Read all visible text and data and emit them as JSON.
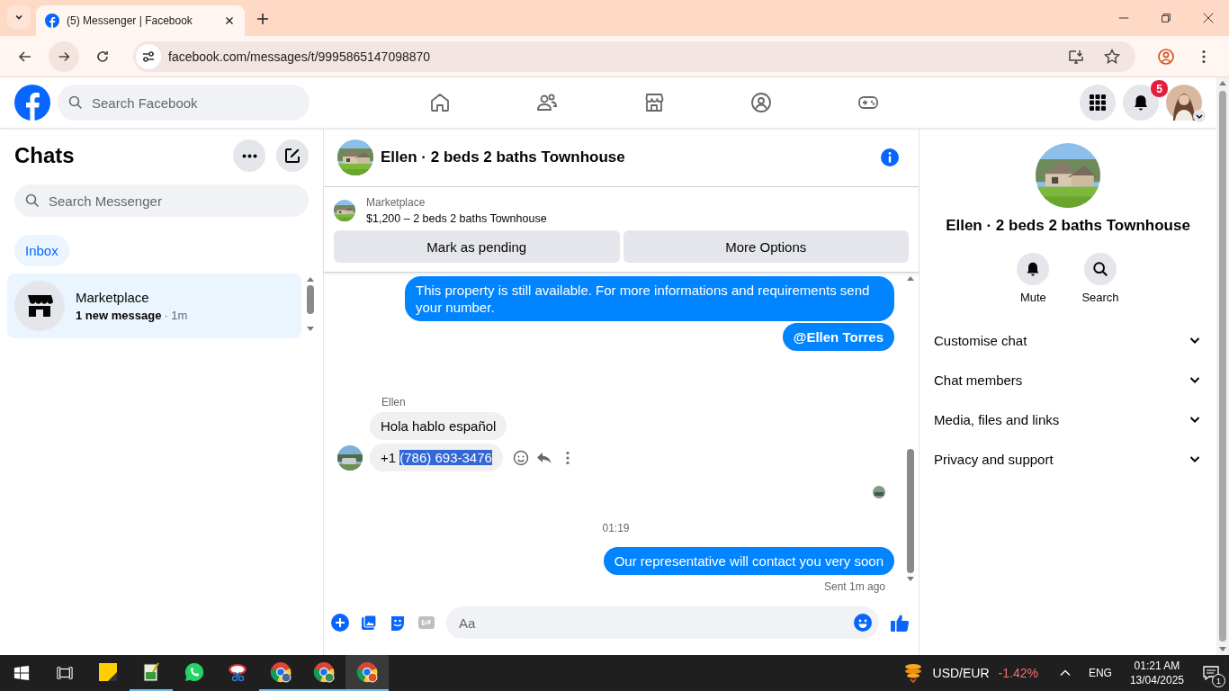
{
  "browser": {
    "tab_title": "(5) Messenger | Facebook",
    "url": "facebook.com/messages/t/9995865147098870"
  },
  "facebook": {
    "search_placeholder": "Search Facebook",
    "notification_count": "5"
  },
  "chats": {
    "title": "Chats",
    "search_placeholder": "Search Messenger",
    "filters": [
      {
        "label": "Inbox",
        "selected": true
      }
    ],
    "conversations": [
      {
        "name": "Marketplace",
        "preview": "1 new message",
        "time": "· 1m",
        "unread": true,
        "selected": true
      }
    ]
  },
  "conversation": {
    "title": "Ellen · 2 beds 2 baths Townhouse",
    "listing": {
      "source": "Marketplace",
      "summary": "$1,200 – 2 beds 2 baths Townhouse"
    },
    "actions": [
      "Mark as pending",
      "More Options"
    ],
    "messages": [
      {
        "kind": "outgoing",
        "text": "This property is still available. For more informations and requirements send your number.",
        "mention": false
      },
      {
        "kind": "outgoing",
        "text": "@Ellen Torres",
        "mention": true
      },
      {
        "kind": "sender",
        "text": "Ellen"
      },
      {
        "kind": "incoming",
        "text": "Hola hablo español",
        "show_avatar": false,
        "hovered": false
      },
      {
        "kind": "incoming",
        "text": "+1 ",
        "highlighted": "(786) 693-3476",
        "show_avatar": true,
        "hovered": true
      },
      {
        "kind": "seen"
      },
      {
        "kind": "time",
        "text": "01:19"
      },
      {
        "kind": "outgoing",
        "text": "Our representative will contact you very soon",
        "mention": false
      },
      {
        "kind": "status",
        "text": "Sent 1m ago"
      }
    ],
    "composer_placeholder": "Aa"
  },
  "details": {
    "name": "Ellen · 2 beds 2 baths Townhouse",
    "actions": [
      "Mute",
      "Search"
    ],
    "sections": [
      {
        "label": "Customise chat",
        "expanded": false
      },
      {
        "label": "Chat members",
        "expanded": false
      },
      {
        "label": "Media, files and links",
        "expanded": false
      },
      {
        "label": "Privacy and support",
        "expanded": false
      }
    ]
  },
  "taskbar": {
    "apps": [
      {
        "running": false,
        "selected": false
      },
      {
        "running": true,
        "selected": false
      },
      {
        "running": false,
        "selected": false
      },
      {
        "running": false,
        "selected": false
      },
      {
        "running": true,
        "selected": false
      },
      {
        "running": true,
        "selected": false
      },
      {
        "running": true,
        "selected": true
      }
    ],
    "ticker": {
      "pair": "USD/EUR",
      "change": "-1.42%"
    },
    "language": "ENG",
    "time": "01:21 AM",
    "date": "13/04/2025",
    "notification_count": "1"
  }
}
